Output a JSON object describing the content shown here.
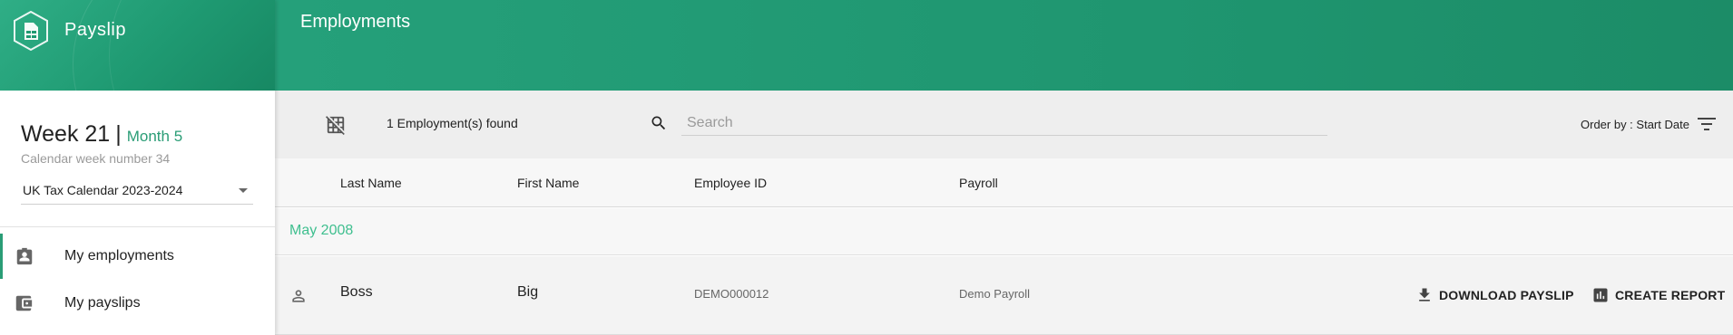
{
  "app": {
    "name": "Payslip"
  },
  "header": {
    "title": "Employments"
  },
  "calendar": {
    "week": "Week 21",
    "separator": "|",
    "month": "Month 5",
    "subtitle": "Calendar week number 34",
    "selected_calendar": "UK Tax Calendar 2023-2024"
  },
  "sidebar": {
    "items": [
      {
        "label": "My employments",
        "icon": "badge-icon",
        "active": true
      },
      {
        "label": "My payslips",
        "icon": "wallet-icon",
        "active": false
      }
    ]
  },
  "toolbar": {
    "found_text": "1 Employment(s) found",
    "search_placeholder": "Search",
    "search_value": "",
    "order_by": "Order by : Start Date"
  },
  "table": {
    "columns": [
      "Last Name",
      "First Name",
      "Employee ID",
      "Payroll"
    ],
    "groups": [
      {
        "label": "May 2008",
        "rows": [
          {
            "last_name": "Boss",
            "first_name": "Big",
            "employee_id": "DEMO000012",
            "payroll": "Demo Payroll",
            "actions": [
              "DOWNLOAD PAYSLIP",
              "CREATE REPORT"
            ]
          }
        ]
      }
    ]
  },
  "colors": {
    "brand": "#1f9a72",
    "accent": "#2a9d76",
    "group_label": "#3fbf8f",
    "toolbar_bg": "#eeeeee"
  }
}
